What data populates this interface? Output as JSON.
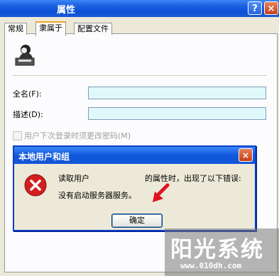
{
  "window": {
    "title": "属性",
    "help": "?",
    "close": "×"
  },
  "tabs": [
    {
      "label": "常规"
    },
    {
      "label": "隶属于"
    },
    {
      "label": "配置文件"
    }
  ],
  "form": {
    "fullname_label": "全名(F):",
    "description_label": "描述(D):",
    "checkbox_label": "用户下次登录时须更改密码(M)"
  },
  "dialog": {
    "title": "本地用户和组",
    "close": "×",
    "msg_part1": "读取用户",
    "msg_part2": "的属性时，出现了以下错误:",
    "msg_line2": "没有启动服务器服务。",
    "ok": "确定"
  },
  "watermark": {
    "title": "阳光系统",
    "url": "www.010dh.com"
  },
  "colors": {
    "titlebar": "#0a4fd8",
    "input_bg": "#e1f8fb",
    "error_icon": "#d11f1f",
    "arrow": "#e0141e"
  }
}
